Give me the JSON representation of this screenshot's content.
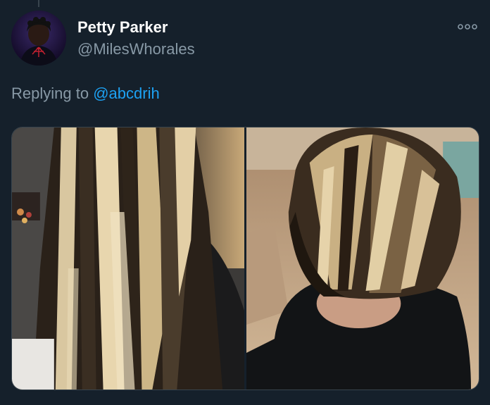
{
  "tweet": {
    "author": {
      "display_name": "Petty Parker",
      "handle": "@MilesWhorales",
      "avatar_icon": "spider-man-avatar"
    },
    "reply": {
      "prefix": "Replying to",
      "mention": "@abcdrih"
    },
    "more_icon": "more-dots-icon",
    "media": [
      {
        "icon": "hair-photo-long-highlights"
      },
      {
        "icon": "hair-photo-bob-highlights"
      }
    ]
  },
  "colors": {
    "background": "#15202b",
    "primary_text": "#ffffff",
    "secondary_text": "#8899a6",
    "accent": "#1da1f2"
  }
}
